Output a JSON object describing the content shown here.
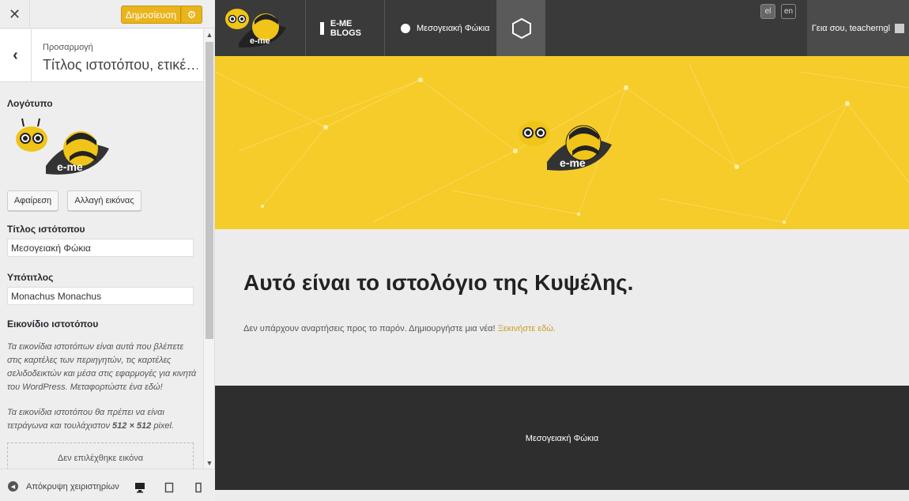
{
  "customizer": {
    "close_glyph": "✕",
    "publish_label": "Δημοσίευση",
    "gear_glyph": "⚙",
    "back_glyph": "‹",
    "section_breadcrumb": "Προσαρμογή",
    "section_title": "Τίτλος ιστοτόπου, ετικέ…",
    "logo_label": "Λογότυπο",
    "remove_button": "Αφαίρεση",
    "change_image_button": "Αλλαγή εικόνας",
    "site_title_label": "Τίτλος ιστότοπου",
    "site_title_value": "Μεσογειακή Φώκια",
    "tagline_label": "Υπότιτλος",
    "tagline_value": "Monachus Monachus",
    "site_icon_label": "Εικονίδιο ιστοτόπου",
    "site_icon_desc_1": "Τα εικονίδια ιστοτόπων είναι αυτά που βλέπετε στις καρτέλες των περιηγητών, τις καρτέλες σελιδοδεικτών και μέσα στις εφαρμογές για κινητά του WordPress. Μεταφορτώστε ένα εδώ!",
    "site_icon_desc_2_prefix": "Τα εικονίδια ιστοτόπου θα πρέπει να είναι τετράγωνα και τουλάχιστον ",
    "site_icon_desc_2_size": "512 × 512",
    "site_icon_desc_2_suffix": " pixel.",
    "no_image_label": "Δεν επιλέχθηκε εικόνα",
    "hide_controls_label": "Απόκρυψη χειριστηρίων"
  },
  "preview": {
    "logo_text": "e-me",
    "blogs_label": "E-ME BLOGS",
    "site_name": "Μεσογειακή Φώκια",
    "lang_el": "el",
    "lang_en": "en",
    "greeting": "Γεια σου, teacherngl",
    "headline": "Αυτό είναι το ιστολόγιο της Κυψέλης.",
    "no_posts": "Δεν υπάρχουν αναρτήσεις προς το παρόν. Δημιουργήστε μια νέα! ",
    "start_here": "Ξεκινήστε εδώ.",
    "footer_text": "Μεσογειακή Φώκια"
  },
  "colors": {
    "accent_yellow": "#f5cc2a",
    "publish": "#e9b41c",
    "dark": "#3a3a3a",
    "link": "#c99b2a"
  }
}
